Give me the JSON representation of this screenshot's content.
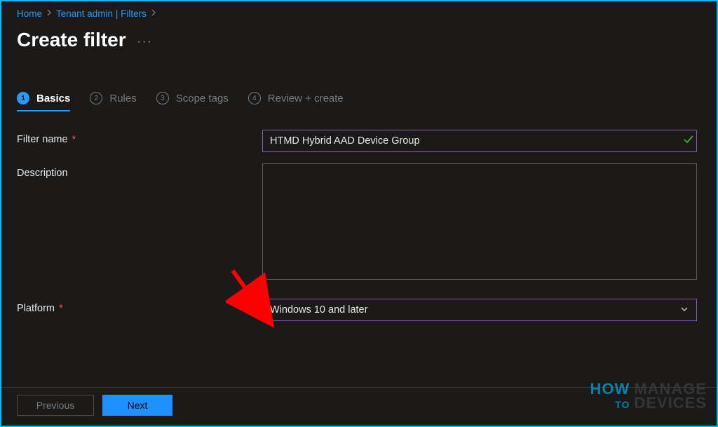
{
  "breadcrumb": {
    "home": "Home",
    "tenant": "Tenant admin | Filters"
  },
  "page": {
    "title": "Create filter"
  },
  "tabs": {
    "basics": {
      "num": "1",
      "label": "Basics"
    },
    "rules": {
      "num": "2",
      "label": "Rules"
    },
    "scope": {
      "num": "3",
      "label": "Scope tags"
    },
    "review": {
      "num": "4",
      "label": "Review + create"
    }
  },
  "form": {
    "filterName": {
      "label": "Filter name",
      "value": "HTMD Hybrid AAD Device Group"
    },
    "description": {
      "label": "Description",
      "value": ""
    },
    "platform": {
      "label": "Platform",
      "value": "Windows 10 and later"
    }
  },
  "footer": {
    "previous": "Previous",
    "next": "Next"
  },
  "watermark": {
    "how": "HOW",
    "manage": "MANAGE",
    "to": "TO",
    "devices": "DEVICES"
  }
}
